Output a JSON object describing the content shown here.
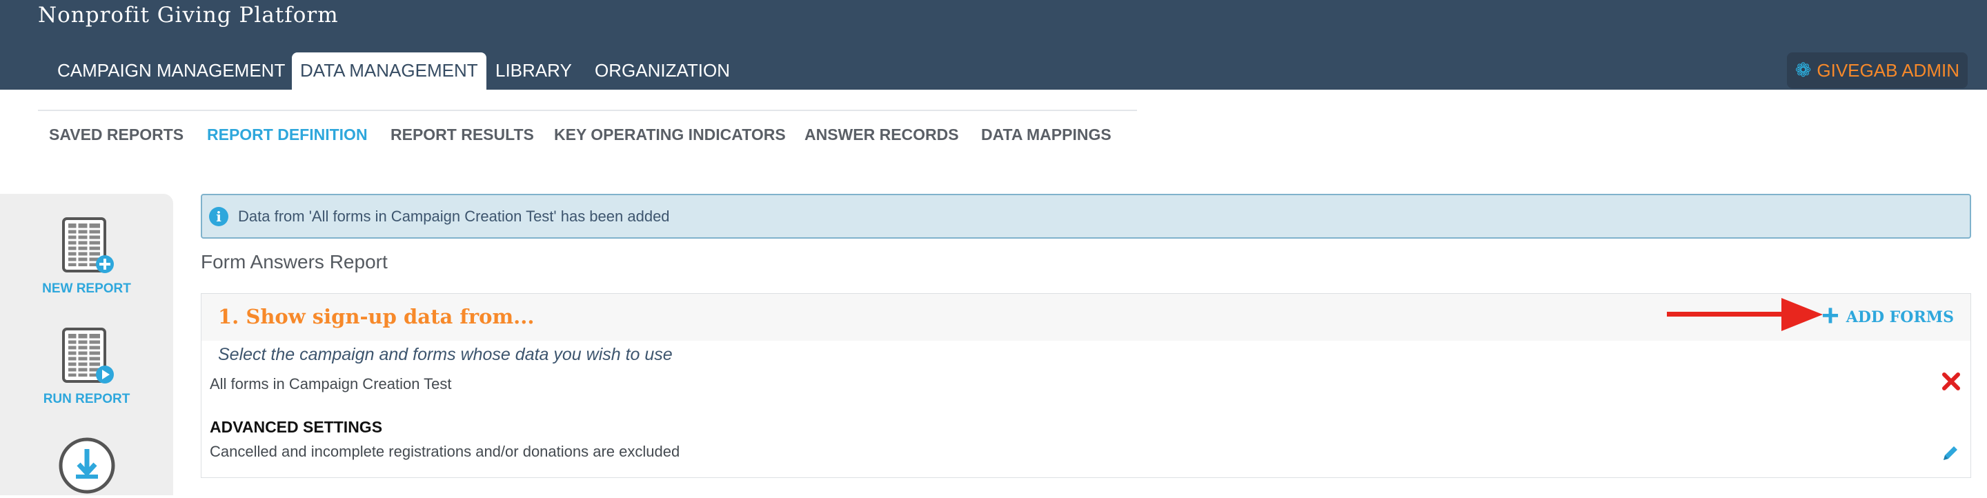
{
  "app": {
    "title": "Nonprofit Giving Platform"
  },
  "main_tabs": [
    {
      "label": "CAMPAIGN MANAGEMENT"
    },
    {
      "label": "DATA MANAGEMENT",
      "active": true
    },
    {
      "label": "LIBRARY"
    },
    {
      "label": "ORGANIZATION"
    }
  ],
  "user_menu": {
    "label": "GIVEGAB ADMIN",
    "icon": "gear-icon"
  },
  "sub_tabs": [
    {
      "label": "SAVED REPORTS"
    },
    {
      "label": "REPORT DEFINITION",
      "active": true
    },
    {
      "label": "REPORT RESULTS"
    },
    {
      "label": "KEY OPERATING INDICATORS"
    },
    {
      "label": "ANSWER RECORDS"
    },
    {
      "label": "DATA MAPPINGS"
    }
  ],
  "sidebar": {
    "actions": [
      {
        "label": "NEW REPORT",
        "icon": "new-report-icon"
      },
      {
        "label": "RUN REPORT",
        "icon": "run-report-icon"
      },
      {
        "label": "",
        "icon": "download-icon"
      }
    ]
  },
  "alert": {
    "text": "Data from 'All forms in Campaign Creation Test' has been added",
    "icon": "info-icon"
  },
  "report": {
    "title": "Form Answers Report",
    "step": {
      "title": "1. Show sign-up data from...",
      "add_button": "ADD FORMS",
      "instruction": "Select the campaign and forms whose data you wish to use",
      "source": "All forms in Campaign Creation Test",
      "advanced_heading": "ADVANCED SETTINGS",
      "advanced_text": "Cancelled and incomplete registrations and/or donations are excluded"
    }
  },
  "colors": {
    "header_bg": "#364c63",
    "accent_blue": "#2ea7dc",
    "accent_orange": "#f7892a",
    "remove_red": "#e02020",
    "annotation_arrow": "#e8261e"
  }
}
